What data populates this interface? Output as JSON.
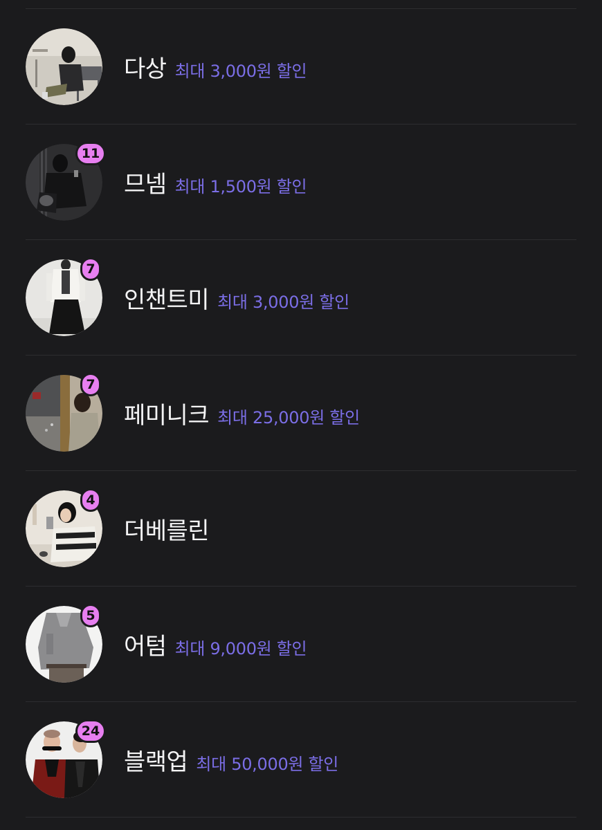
{
  "shops": [
    {
      "name": "다상",
      "discount": "최대 3,000원 할인",
      "badge": "",
      "avatar_desc": "woman-sitting-photo"
    },
    {
      "name": "므넴",
      "discount": "최대 1,500원 할인",
      "badge": "11",
      "avatar_desc": "woman-black-outfit-photo"
    },
    {
      "name": "인챈트미",
      "discount": "최대 3,000원 할인",
      "badge": "7",
      "avatar_desc": "woman-white-blazer-photo"
    },
    {
      "name": "페미니크",
      "discount": "최대 25,000원 할인",
      "badge": "7",
      "avatar_desc": "woman-street-photo"
    },
    {
      "name": "더베를린",
      "discount": "",
      "badge": "4",
      "avatar_desc": "woman-mirror-selfie-photo"
    },
    {
      "name": "어텀",
      "discount": "최대 9,000원 할인",
      "badge": "5",
      "avatar_desc": "grey-knit-sweater-photo"
    },
    {
      "name": "블랙업",
      "discount": "최대 50,000원 할인",
      "badge": "24",
      "avatar_desc": "couple-leather-jackets-photo"
    }
  ],
  "colors": {
    "background": "#1b1b1d",
    "divider": "#2d2d30",
    "brand_text": "#f4f4f5",
    "discount_text": "#7b6ee6",
    "badge_bg": "#e77ff0"
  }
}
